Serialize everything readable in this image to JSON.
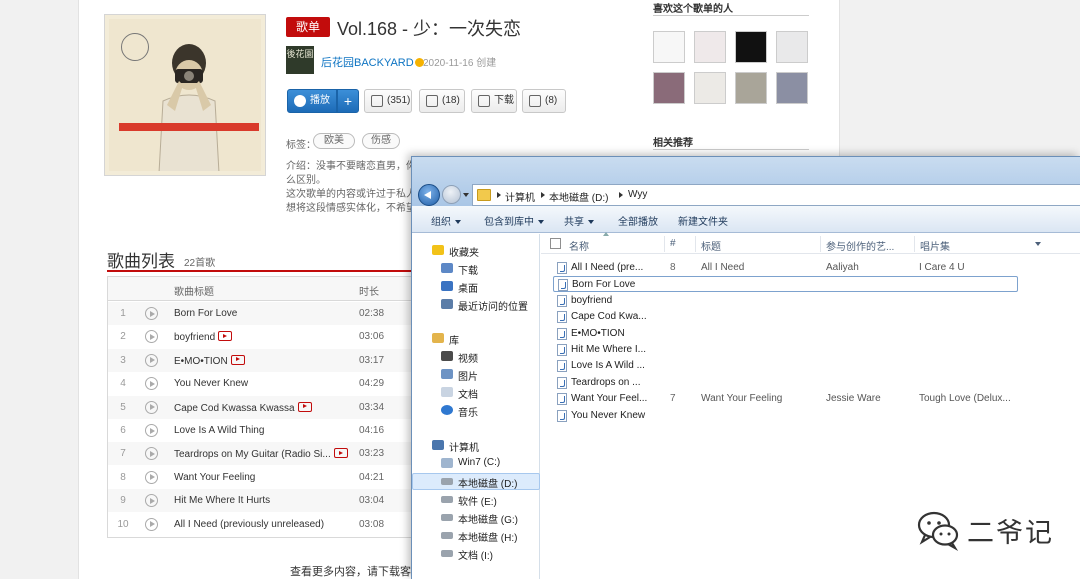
{
  "playlist": {
    "badge": "歌单",
    "title": "Vol.168 - 少：一次失恋",
    "creator_avatar_text": "後花園",
    "creator": "后花园BACKYARD",
    "created": "2020-11-16 创建",
    "buttons": {
      "play": "播放",
      "add": "+",
      "favorite": "(351)",
      "share": "(18)",
      "download": "下载",
      "comment": "(8)"
    },
    "tags_label": "标签：",
    "tags": [
      "欧美",
      "伤感"
    ],
    "intro_line1": "介绍：没事不要瞎恋直男，你",
    "intro_line2": "么区别。",
    "intro_line3": "这次歌单的内容或许过于私人",
    "intro_line4": "想将这段情感实体化，不希望"
  },
  "song_list": {
    "title": "歌曲列表",
    "count": "22首歌",
    "headers": {
      "title": "歌曲标题",
      "duration": "时长"
    },
    "songs": [
      {
        "num": "1",
        "name": "Born For Love",
        "mv": false,
        "duration": "02:38"
      },
      {
        "num": "2",
        "name": "boyfriend",
        "mv": true,
        "duration": "03:06"
      },
      {
        "num": "3",
        "name": "E•MO•TION",
        "mv": true,
        "duration": "03:17"
      },
      {
        "num": "4",
        "name": "You Never Knew",
        "mv": false,
        "duration": "04:29"
      },
      {
        "num": "5",
        "name": "Cape Cod Kwassa Kwassa",
        "mv": true,
        "duration": "03:34"
      },
      {
        "num": "6",
        "name": "Love Is A Wild Thing",
        "mv": false,
        "duration": "04:16"
      },
      {
        "num": "7",
        "name": "Teardrops on My Guitar (Radio Si...",
        "mv": true,
        "duration": "03:23"
      },
      {
        "num": "8",
        "name": "Want Your Feeling",
        "mv": false,
        "duration": "04:21"
      },
      {
        "num": "9",
        "name": "Hit Me Where It Hurts",
        "mv": false,
        "duration": "03:04"
      },
      {
        "num": "10",
        "name": "All I Need (previously unreleased)",
        "mv": false,
        "duration": "03:08"
      }
    ],
    "more_hint": "查看更多内容，请下载客户"
  },
  "sidebar": {
    "likers_title": "喜欢这个歌单的人",
    "related_title": "相关推荐"
  },
  "explorer": {
    "path": [
      "计算机",
      "本地磁盘 (D:)",
      "Wyy"
    ],
    "toolbar": [
      "组织",
      "包含到库中",
      "共享",
      "全部播放",
      "新建文件夹"
    ],
    "nav": {
      "favorites": "收藏夹",
      "downloads": "下载",
      "desktop": "桌面",
      "recent": "最近访问的位置",
      "libraries": "库",
      "videos": "视频",
      "pictures": "图片",
      "documents": "文档",
      "music": "音乐",
      "computer": "计算机",
      "drive_c": "Win7 (C:)",
      "drive_d": "本地磁盘 (D:)",
      "drive_e": "软件 (E:)",
      "drive_g": "本地磁盘 (G:)",
      "drive_h": "本地磁盘 (H:)",
      "drive_i": "文档 (I:)"
    },
    "columns": {
      "name": "名称",
      "num": "#",
      "title": "标题",
      "artist": "参与创作的艺...",
      "album": "唱片集"
    },
    "files": [
      {
        "name": "All I Need (pre...",
        "num": "8",
        "title": "All I Need",
        "artist": "Aaliyah",
        "album": "I Care 4 U"
      },
      {
        "name": "Born For Love",
        "num": "",
        "title": "",
        "artist": "",
        "album": ""
      },
      {
        "name": "boyfriend",
        "num": "",
        "title": "",
        "artist": "",
        "album": ""
      },
      {
        "name": "Cape Cod Kwa...",
        "num": "",
        "title": "",
        "artist": "",
        "album": ""
      },
      {
        "name": "E•MO•TION",
        "num": "",
        "title": "",
        "artist": "",
        "album": ""
      },
      {
        "name": "Hit Me Where I...",
        "num": "",
        "title": "",
        "artist": "",
        "album": ""
      },
      {
        "name": "Love Is A Wild ...",
        "num": "",
        "title": "",
        "artist": "",
        "album": ""
      },
      {
        "name": "Teardrops on ...",
        "num": "",
        "title": "",
        "artist": "",
        "album": ""
      },
      {
        "name": "Want Your Feel...",
        "num": "7",
        "title": "Want Your Feeling",
        "artist": "Jessie Ware",
        "album": "Tough Love (Delux..."
      },
      {
        "name": "You Never Knew",
        "num": "",
        "title": "",
        "artist": "",
        "album": ""
      }
    ]
  },
  "watermark": {
    "text": "二爷记"
  },
  "colors": {
    "netease_red": "#c20c0c",
    "link_blue": "#0c73c2",
    "play_blue": "#1d6bb7"
  }
}
